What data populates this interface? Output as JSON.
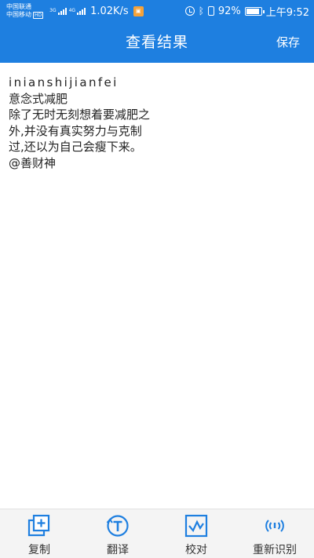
{
  "status_bar": {
    "carrier_1": "中国联通",
    "carrier_2": "中国移动",
    "hd_badge": "HD",
    "net_1": "3G",
    "net_2": "4G",
    "speed": "1.02K/s",
    "battery": "92%",
    "time": "上午9:52"
  },
  "header": {
    "title": "查看结果",
    "save_label": "保存"
  },
  "result": {
    "lines": [
      "inianshijianfei",
      "意念式减肥",
      "除了无时无刻想着要减肥之",
      "外,并没有真实努力与克制",
      "过,还以为自己会瘦下来。",
      "@善财神"
    ]
  },
  "toolbar": {
    "items": [
      {
        "label": "复制",
        "icon": "copy-icon"
      },
      {
        "label": "翻译",
        "icon": "translate-icon"
      },
      {
        "label": "校对",
        "icon": "proofread-icon"
      },
      {
        "label": "重新识别",
        "icon": "re-recognize-icon"
      }
    ]
  },
  "colors": {
    "accent": "#1e7fe0",
    "toolbar_bg": "#f4f4f4",
    "text": "#222222"
  }
}
